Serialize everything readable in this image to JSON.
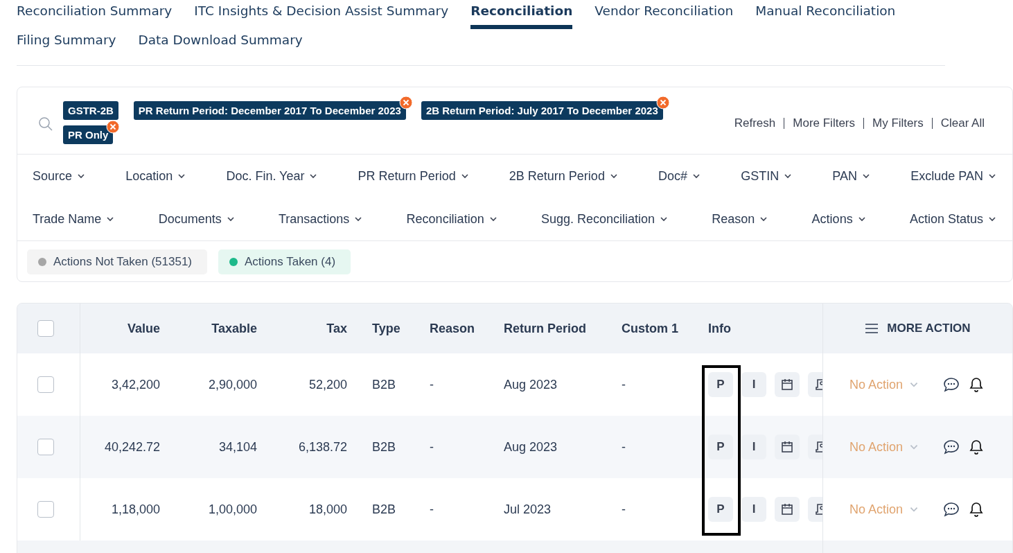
{
  "tabs": [
    {
      "label": "Reconciliation Summary",
      "selected": false
    },
    {
      "label": "ITC Insights & Decision Assist Summary",
      "selected": false
    },
    {
      "label": "Reconciliation",
      "selected": true
    },
    {
      "label": "Vendor Reconciliation",
      "selected": false
    },
    {
      "label": "Manual Reconciliation",
      "selected": false
    },
    {
      "label": "Filing Summary",
      "selected": false
    },
    {
      "label": "Data Download Summary",
      "selected": false
    }
  ],
  "filter_chips": [
    {
      "label": "GSTR-2B",
      "removable": false
    },
    {
      "label": "PR Return Period: December 2017 To December 2023",
      "removable": true
    },
    {
      "label": "2B Return Period: July 2017 To December 2023",
      "removable": true
    },
    {
      "label": "PR Only",
      "removable": true
    }
  ],
  "filter_links": [
    "Refresh",
    "More Filters",
    "My Filters",
    "Clear All"
  ],
  "filter_dropdowns": [
    [
      "Source",
      "Location",
      "Doc. Fin. Year",
      "PR Return Period",
      "2B Return Period",
      "Doc#",
      "GSTIN",
      "PAN",
      "Exclude PAN"
    ],
    [
      "Trade Name",
      "Documents",
      "Transactions",
      "Reconciliation",
      "Sugg. Reconciliation",
      "Reason",
      "Actions",
      "Action Status"
    ]
  ],
  "status_pills": [
    {
      "label": "Actions Not Taken (51351)",
      "color": "#a6a6a6",
      "selected": false
    },
    {
      "label": "Actions Taken (4)",
      "color": "#1db98a",
      "selected": true
    }
  ],
  "table": {
    "select_all_checked": false,
    "columns": [
      "Value",
      "Taxable",
      "Tax",
      "Type",
      "Reason",
      "Return Period",
      "Custom 1",
      "Info"
    ],
    "more_action_label": "MORE ACTION",
    "rows": [
      {
        "checked": false,
        "cells": [
          "3,42,200",
          "2,90,000",
          "52,200",
          "B2B",
          "-",
          "Aug 2023",
          "-"
        ],
        "badges": [
          "P",
          "I"
        ],
        "action": "No Action"
      },
      {
        "checked": false,
        "cells": [
          "40,242.72",
          "34,104",
          "6,138.72",
          "B2B",
          "-",
          "Aug 2023",
          "-"
        ],
        "badges": [
          "P",
          "I"
        ],
        "action": "No Action"
      },
      {
        "checked": false,
        "cells": [
          "1,18,000",
          "1,00,000",
          "18,000",
          "B2B",
          "-",
          "Jul 2023",
          "-"
        ],
        "badges": [
          "P",
          "I"
        ],
        "action": "No Action"
      }
    ]
  }
}
